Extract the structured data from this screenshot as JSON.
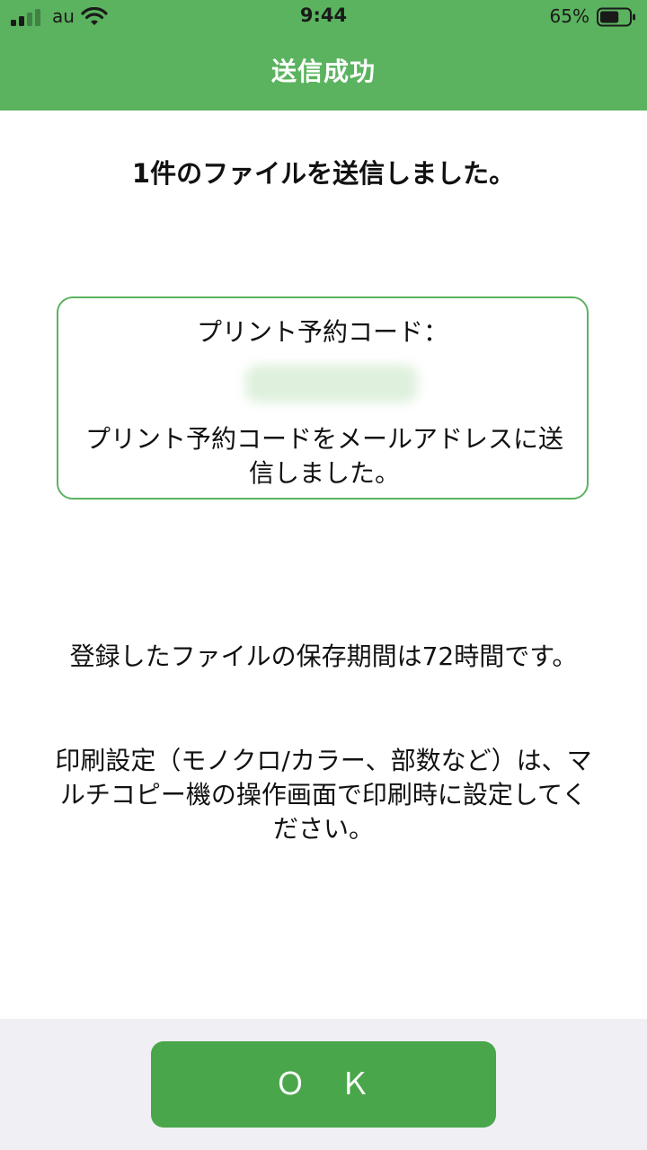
{
  "status_bar": {
    "carrier": "au",
    "time": "9:44",
    "battery_percent": "65%",
    "battery_level": 0.65,
    "signal_bars": 2,
    "signal_bars_total": 4,
    "signal_icon": "cellular-signal-icon",
    "wifi_icon": "wifi-icon",
    "battery_icon": "battery-icon"
  },
  "header": {
    "title": "送信成功"
  },
  "main": {
    "headline": "1件のファイルを送信しました。",
    "code_box": {
      "label": "プリント予約コード：",
      "code_value": "",
      "note": "プリント予約コードをメールアドレスに送信しました。"
    },
    "retention_text": "登録したファイルの保存期間は72時間です。",
    "print_settings_text": "印刷設定（モノクロ/カラー、部数など）は、マルチコピー機の操作画面で印刷時に設定してください。"
  },
  "footer": {
    "ok_label": "Ｏ　Ｋ"
  },
  "colors": {
    "header_green": "#5bb35f",
    "button_green": "#4aa64b",
    "footer_bg": "#efeff4",
    "border_green": "#5bb35f"
  }
}
